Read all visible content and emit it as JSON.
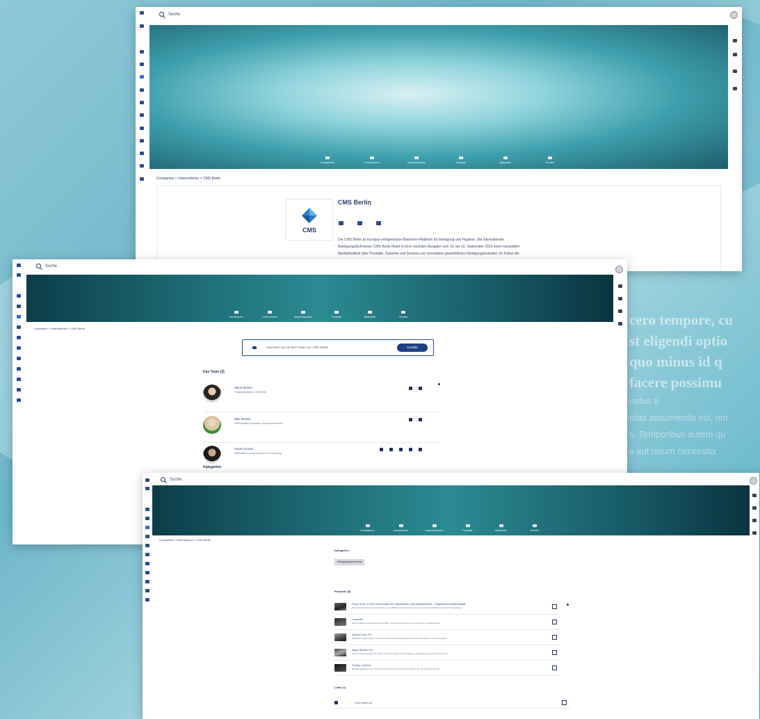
{
  "search_label": "Suche",
  "hero_nav": [
    "Kontaktieren",
    "Unternehmen",
    "Ansprechpartner",
    "Produkte",
    "Mitarbeiter",
    "Termine"
  ],
  "profile": {
    "breadcrumb": "Companies > Unternehmen > CMS Berlin",
    "company_name": "CMS Berlin",
    "logo_text": "CMS",
    "description": [
      "Die CMS Berlin ist Europas erfolgreichste Branchen-Plattform für Reinigung und Hygiene. Die internationale",
      "Reinigungsfachmesse CMS Berlin findet in ihrer nächsten Ausgabe vom 16. bis 22. September 2025 einen kompletten",
      "Marktüberblick über Produkte, Systeme und Services zur innovativen gewerblichen Reinigungsindustrie. Im Fokus der"
    ]
  },
  "contacts_screen": {
    "breadcrumb": "Companies > Unternehmen > CMS Berlin",
    "cta_text": "Sprechen Sie mit dem Team von CMS Berlin",
    "cta_button": "Kontakt",
    "section_title": "Das Team (3)",
    "contacts": [
      {
        "name": "Maria Muster",
        "role": "Projektmanagerin CMS Berlin"
      },
      {
        "name": "Max Muster",
        "role": "Vertriebsleiter Aussteller und Besucher Berlin"
      },
      {
        "name": "Sarah Schulz",
        "role": "Mitarbeiterin Kommunikation und Marketing"
      }
    ],
    "next_section": "Kategorien"
  },
  "products_screen": {
    "breadcrumb": "Companies > Unternehmen > CMS Berlin",
    "category_title": "Kategorien",
    "category_tag": "Reinigungsfachmesse",
    "products_title": "Produkte (5)",
    "products": [
      {
        "title": "Purus Sole: 5 Wet Vacuumator für Marktplätze und Nassbereiche – Standard Einzelbaustück",
        "sub": "Professionelle Reinigungsmaschine für großflächige Nassbereiche, Hallen und Industrieflächen mit hoher Saugleistung"
      },
      {
        "title": "Lavanda",
        "sub": "Ein kompaktes Reinigungsgerät für Büro, Praxis und Gastronomie mit geringem Geräuschpegel"
      },
      {
        "title": "Jasmin One Pro",
        "sub": "Kabelloser Staubsauger für professionelle Unterhaltsreinigung mit langer Akkulaufzeit und Filtersystem"
      },
      {
        "title": "Aqua Stratos Pro",
        "sub": "Scheuersaugmaschine für mittlere bis große Flächen mit intelligenter Wasserdosierung und Tanksystem"
      },
      {
        "title": "Trolley Comfort",
        "sub": "Reinigungswagen mit modularem Aufbau, Eimern und Zubehörhaltern für den täglichen Einsatz"
      }
    ],
    "links_title": "Links (1)",
    "link": "cms-berlin.de"
  },
  "background_text": [
    "cero tempore, cu",
    "st eligendi optio",
    "quo minus id q",
    "facere possimu"
  ],
  "background_small": [
    "natus e",
    "ptas assumenda est, om",
    "s. Temporibus autem qu",
    "s aut rerum necessita"
  ],
  "colors": {
    "primary": "#1f3f85",
    "hero_light": "#8fd3dc",
    "hero_dark": "#0c3d48"
  }
}
